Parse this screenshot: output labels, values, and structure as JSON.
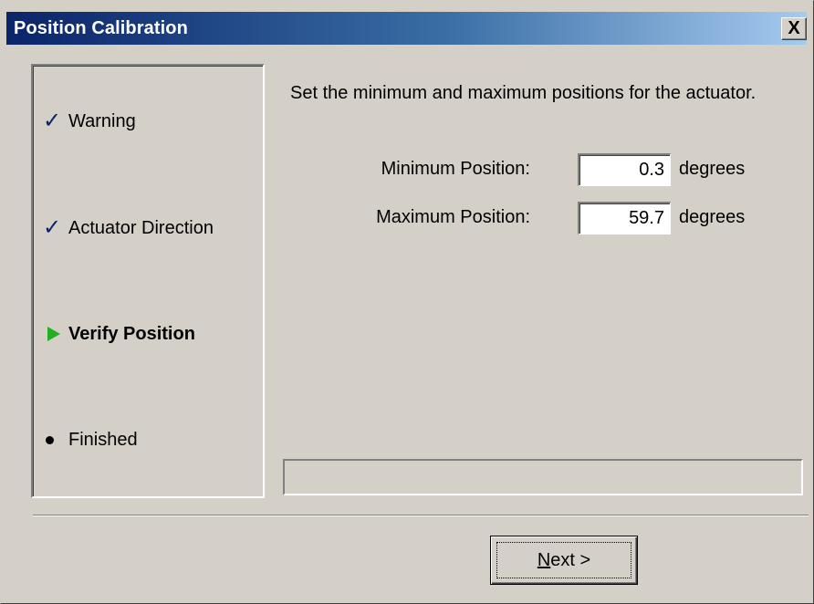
{
  "window": {
    "title": "Position Calibration",
    "close_label": "X"
  },
  "steps": [
    {
      "label": "Warning",
      "status": "complete",
      "icon": "check-icon"
    },
    {
      "label": "Actuator Direction",
      "status": "complete",
      "icon": "check-icon"
    },
    {
      "label": "Verify Position",
      "status": "current",
      "icon": "green-arrow-icon"
    },
    {
      "label": "Finished",
      "status": "pending",
      "icon": "bullet-icon"
    }
  ],
  "main": {
    "instructions": "Set the minimum and maximum positions for the actuator.",
    "fields": [
      {
        "label": "Minimum Position:",
        "value": "0.3",
        "unit": "degrees"
      },
      {
        "label": "Maximum Position:",
        "value": "59.7",
        "unit": "degrees"
      }
    ],
    "status_text": ""
  },
  "buttons": {
    "next_mnemonic": "N",
    "next_rest": "ext >"
  },
  "colors": {
    "titlebar_start": "#0a246a",
    "titlebar_end": "#a6caf0",
    "dialog_face": "#d4d0c8",
    "check": "#0a246a",
    "current_arrow": "#22b022"
  }
}
